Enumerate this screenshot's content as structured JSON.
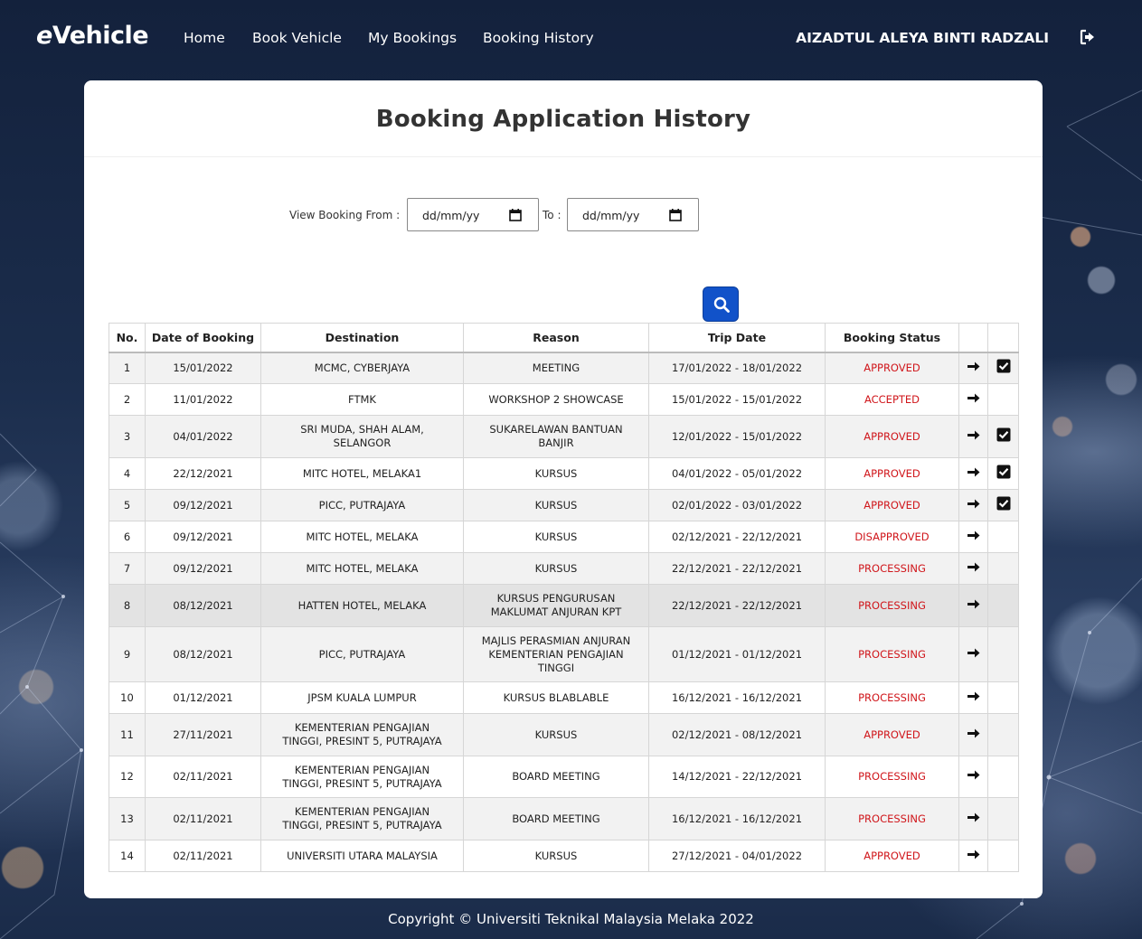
{
  "navbar": {
    "brand_e": "e",
    "brand_rest": "Vehicle",
    "links": [
      "Home",
      "Book Vehicle",
      "My Bookings",
      "Booking History"
    ],
    "user_name": "AIZADTUL ALEYA BINTI RADZALI",
    "logout_icon": "sign-out-icon"
  },
  "page": {
    "title": "Booking Application History",
    "filter": {
      "from_label": "View Booking From :",
      "from_value": "dd/mm/yy",
      "to_label": "To :",
      "to_value": "dd/mm/yy"
    },
    "search_icon": "search-icon",
    "accent_color": "#1152c9",
    "status_color": "#d0161b"
  },
  "table": {
    "headers": [
      "No.",
      "Date of Booking",
      "Destination",
      "Reason",
      "Trip Date",
      "Booking Status",
      "",
      ""
    ],
    "rows": [
      {
        "no": "1",
        "date": "15/01/2022",
        "dest": [
          "MCMC, CYBERJAYA"
        ],
        "reason": [
          "MEETING"
        ],
        "trip": "17/01/2022 - 18/01/2022",
        "status": "APPROVED",
        "checked": true
      },
      {
        "no": "2",
        "date": "11/01/2022",
        "dest": [
          "FTMK"
        ],
        "reason": [
          "WORKSHOP 2 SHOWCASE"
        ],
        "trip": "15/01/2022 - 15/01/2022",
        "status": "ACCEPTED",
        "checked": false
      },
      {
        "no": "3",
        "date": "04/01/2022",
        "dest": [
          "SRI MUDA, SHAH ALAM,",
          "SELANGOR"
        ],
        "reason": [
          "SUKARELAWAN BANTUAN",
          "BANJIR"
        ],
        "trip": "12/01/2022 - 15/01/2022",
        "status": "APPROVED",
        "checked": true
      },
      {
        "no": "4",
        "date": "22/12/2021",
        "dest": [
          "MITC HOTEL, MELAKA1"
        ],
        "reason": [
          "KURSUS"
        ],
        "trip": "04/01/2022 - 05/01/2022",
        "status": "APPROVED",
        "checked": true
      },
      {
        "no": "5",
        "date": "09/12/2021",
        "dest": [
          "PICC, PUTRAJAYA"
        ],
        "reason": [
          "KURSUS"
        ],
        "trip": "02/01/2022 - 03/01/2022",
        "status": "APPROVED",
        "checked": true
      },
      {
        "no": "6",
        "date": "09/12/2021",
        "dest": [
          "MITC HOTEL, MELAKA"
        ],
        "reason": [
          "KURSUS"
        ],
        "trip": "02/12/2021 - 22/12/2021",
        "status": "DISAPPROVED",
        "checked": false
      },
      {
        "no": "7",
        "date": "09/12/2021",
        "dest": [
          "MITC HOTEL, MELAKA"
        ],
        "reason": [
          "KURSUS"
        ],
        "trip": "22/12/2021 - 22/12/2021",
        "status": "PROCESSING",
        "checked": false
      },
      {
        "no": "8",
        "date": "08/12/2021",
        "dest": [
          "HATTEN HOTEL, MELAKA"
        ],
        "reason": [
          "KURSUS PENGURUSAN",
          "MAKLUMAT ANJURAN KPT"
        ],
        "trip": "22/12/2021 - 22/12/2021",
        "status": "PROCESSING",
        "checked": false
      },
      {
        "no": "9",
        "date": "08/12/2021",
        "dest": [
          "PICC, PUTRAJAYA"
        ],
        "reason": [
          "MAJLIS PERASMIAN ANJURAN",
          "KEMENTERIAN PENGAJIAN",
          "TINGGI"
        ],
        "trip": "01/12/2021 - 01/12/2021",
        "status": "PROCESSING",
        "checked": false
      },
      {
        "no": "10",
        "date": "01/12/2021",
        "dest": [
          "JPSM KUALA LUMPUR"
        ],
        "reason": [
          "KURSUS BLABLABLE"
        ],
        "trip": "16/12/2021 - 16/12/2021",
        "status": "PROCESSING",
        "checked": false
      },
      {
        "no": "11",
        "date": "27/11/2021",
        "dest": [
          "KEMENTERIAN PENGAJIAN",
          "TINGGI, PRESINT 5, PUTRAJAYA"
        ],
        "reason": [
          "KURSUS"
        ],
        "trip": "02/12/2021 - 08/12/2021",
        "status": "APPROVED",
        "checked": false
      },
      {
        "no": "12",
        "date": "02/11/2021",
        "dest": [
          "KEMENTERIAN PENGAJIAN",
          "TINGGI, PRESINT 5, PUTRAJAYA"
        ],
        "reason": [
          "BOARD MEETING"
        ],
        "trip": "14/12/2021 - 22/12/2021",
        "status": "PROCESSING",
        "checked": false
      },
      {
        "no": "13",
        "date": "02/11/2021",
        "dest": [
          "KEMENTERIAN PENGAJIAN",
          "TINGGI, PRESINT 5, PUTRAJAYA"
        ],
        "reason": [
          "BOARD MEETING"
        ],
        "trip": "16/12/2021 - 16/12/2021",
        "status": "PROCESSING",
        "checked": false
      },
      {
        "no": "14",
        "date": "02/11/2021",
        "dest": [
          "UNIVERSITI UTARA MALAYSIA"
        ],
        "reason": [
          "KURSUS"
        ],
        "trip": "27/12/2021 - 04/01/2022",
        "status": "APPROVED",
        "checked": false
      }
    ],
    "row_action_icon": "arrow-right-icon",
    "row_check_icon": "check-square-icon"
  },
  "footer": {
    "text": "Copyright © Universiti Teknikal Malaysia Melaka 2022"
  }
}
